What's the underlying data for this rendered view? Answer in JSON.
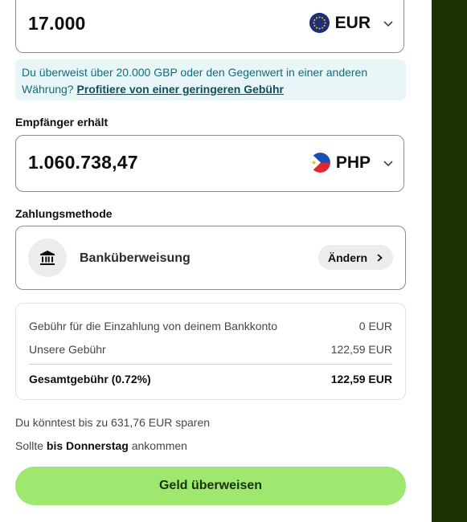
{
  "send": {
    "amount": "17.000",
    "currency": "EUR",
    "flag_icon": "eu-flag-icon"
  },
  "info_banner": {
    "text": "Du überweist über 20.000 GBP oder den Gegenwert in einer anderen Währung? ",
    "link": "Profitiere von einer geringeren Gebühr"
  },
  "recipient": {
    "label": "Empfänger erhält",
    "amount": "1.060.738,47",
    "currency": "PHP",
    "flag_icon": "philippines-flag-icon"
  },
  "payment_method": {
    "label": "Zahlungsmethode",
    "name": "Banküberweisung",
    "icon": "bank-icon",
    "change_label": "Ändern"
  },
  "fees": {
    "rows": [
      {
        "label": "Gebühr für die Einzahlung von deinem Bankkonto",
        "value": "0 EUR"
      },
      {
        "label": "Unsere Gebühr",
        "value": "122,59 EUR"
      }
    ],
    "total_label": "Gesamtgebühr (0.72%)",
    "total_value": "122,59 EUR"
  },
  "savings_text": "Du könntest bis zu 631,76 EUR sparen",
  "arrival": {
    "prefix": "Sollte ",
    "bold": "bis Donnerstag",
    "suffix": " ankommen"
  },
  "cta_label": "Geld überweisen",
  "colors": {
    "cta": "#9fe870",
    "banner_bg": "#e9f6f7",
    "side_strip": "#1b3304"
  }
}
